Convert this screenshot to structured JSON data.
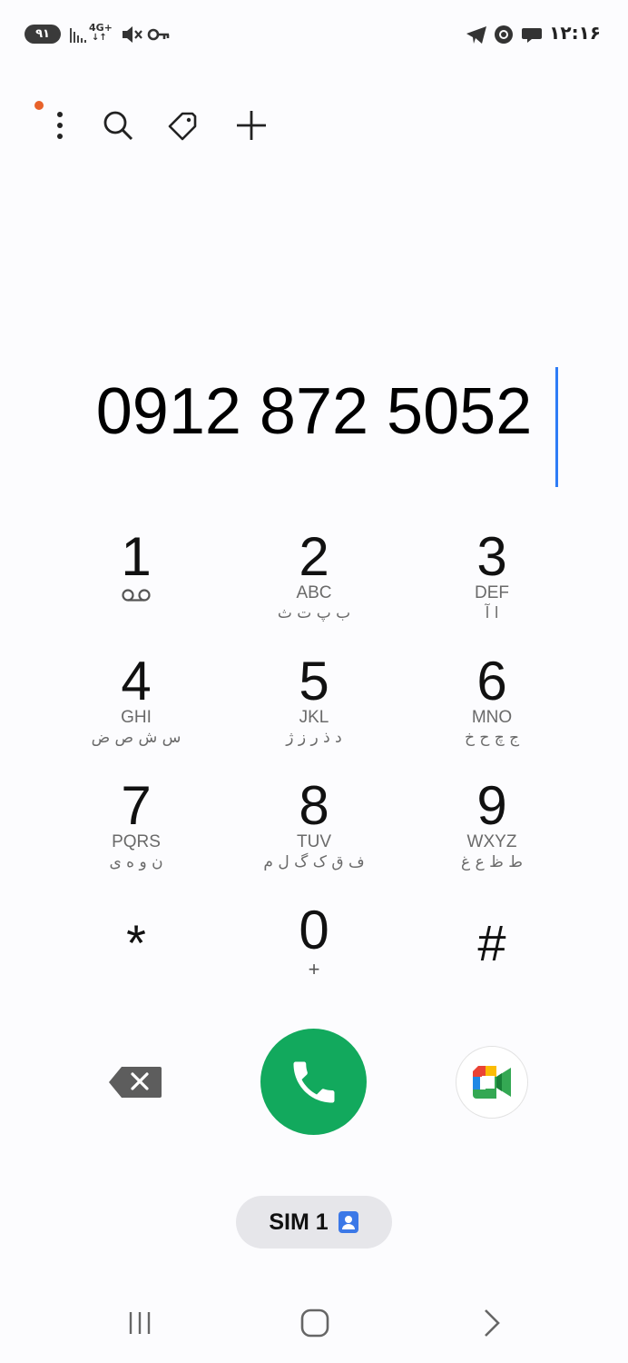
{
  "status_bar": {
    "battery_level": "۹۱",
    "network_type": "4G+",
    "time": "۱۲:۱۶",
    "icons": [
      "signal-icon",
      "network-4g-icon",
      "mute-icon",
      "vpn-key-icon",
      "telegram-icon",
      "chrome-icon",
      "chat-icon"
    ]
  },
  "toolbar": {
    "icons": [
      "more-options-icon",
      "search-icon",
      "tag-icon",
      "add-contact-icon"
    ],
    "notification_dot_color": "#e8622a"
  },
  "dialer": {
    "number": "0912 872 5052",
    "cursor_color": "#2e7cf6"
  },
  "keypad": {
    "keys": [
      {
        "digit": "1",
        "letters": "",
        "persian": "",
        "sub_icon": "voicemail-icon"
      },
      {
        "digit": "2",
        "letters": "ABC",
        "persian": "ب پ ت ث"
      },
      {
        "digit": "3",
        "letters": "DEF",
        "persian": "ا آ"
      },
      {
        "digit": "4",
        "letters": "GHI",
        "persian": "س ش ص ض"
      },
      {
        "digit": "5",
        "letters": "JKL",
        "persian": "د ذ ر ز ژ"
      },
      {
        "digit": "6",
        "letters": "MNO",
        "persian": "ج چ ح خ"
      },
      {
        "digit": "7",
        "letters": "PQRS",
        "persian": "ن و ه ی"
      },
      {
        "digit": "8",
        "letters": "TUV",
        "persian": "ف ق ک گ ل م"
      },
      {
        "digit": "9",
        "letters": "WXYZ",
        "persian": "ط ظ ع غ"
      },
      {
        "digit": "*",
        "letters": "",
        "persian": ""
      },
      {
        "digit": "0",
        "letters": "+",
        "persian": ""
      },
      {
        "digit": "#",
        "letters": "",
        "persian": ""
      }
    ]
  },
  "actions": {
    "call_color": "#12a95d",
    "backspace_color": "#5d5d5d",
    "sim_label": "SIM 1",
    "sim_icon_color": "#3b78e7"
  },
  "nav_bar": {
    "icons": [
      "recent-apps-icon",
      "home-icon",
      "back-icon"
    ]
  }
}
